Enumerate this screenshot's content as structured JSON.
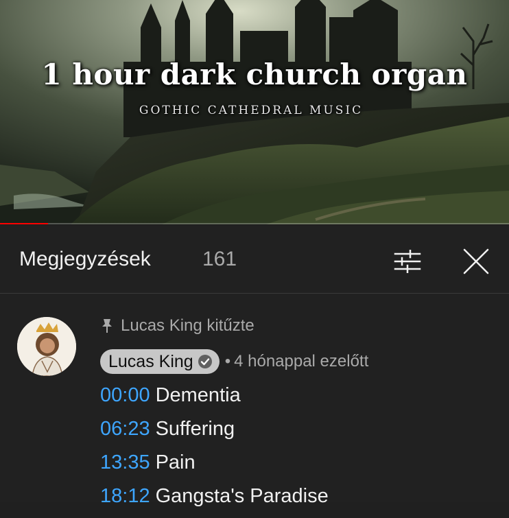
{
  "video": {
    "title": "1 hour dark church organ",
    "subtitle": "GOTHIC CATHEDRAL MUSIC",
    "progress_fraction": 0.095,
    "progress_color": "#ff0000"
  },
  "comments": {
    "title": "Megjegyzések",
    "count": "161",
    "filter_icon": "sort-filter-icon",
    "close_icon": "close-icon"
  },
  "comment": {
    "pinned_label": "Lucas King kitűzte",
    "author": "Lucas King",
    "separator": "•",
    "time": "4 hónappal ezelőtt",
    "tracks": [
      {
        "timestamp": "00:00",
        "title": "Dementia"
      },
      {
        "timestamp": "06:23",
        "title": "Suffering"
      },
      {
        "timestamp": "13:35",
        "title": "Pain"
      },
      {
        "timestamp": "18:12",
        "title": "Gangsta's Paradise"
      }
    ]
  },
  "colors": {
    "panel_bg": "#212121",
    "timestamp_link": "#3ea6ff",
    "muted_text": "#aaaaaa"
  }
}
